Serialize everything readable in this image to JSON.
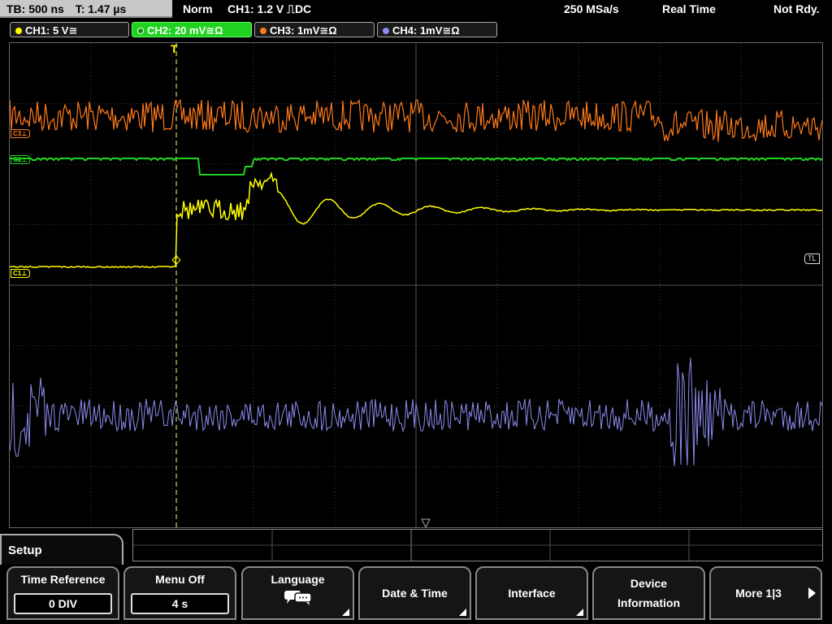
{
  "status": {
    "timebase": "TB: 500 ns",
    "trigger_time": "T: 1.47 µs",
    "mode": "Norm",
    "trigger": "CH1: 1.2 V ⎍DC",
    "sample_rate": "250 MSa/s",
    "acq_mode": "Real Time",
    "ready_state": "Not Rdy."
  },
  "channels": [
    {
      "label": "CH1: 5 V≅",
      "color": "#ffff00"
    },
    {
      "label": "CH2: 20 mV≅Ω",
      "color": "#1fd21f"
    },
    {
      "label": "CH3: 1mV≅Ω",
      "color": "#ff7a1a"
    },
    {
      "label": "CH4: 1mV≅Ω",
      "color": "#8c8cf0"
    }
  ],
  "markers": {
    "c3": "C3⊥",
    "c2": "C2⊥",
    "c1": "C1⊥",
    "tl": "TL",
    "trigger": "T"
  },
  "menu": {
    "title": "Setup",
    "keys": [
      {
        "title": "Time Reference",
        "value": "0 DIV"
      },
      {
        "title": "Menu Off",
        "value": "4 s"
      },
      {
        "title": "Language",
        "icon": "speech-bubbles-icon"
      },
      {
        "title": "Date & Time"
      },
      {
        "title": "Interface"
      },
      {
        "title": "Device Information"
      },
      {
        "title": "More 1|3"
      }
    ]
  }
}
